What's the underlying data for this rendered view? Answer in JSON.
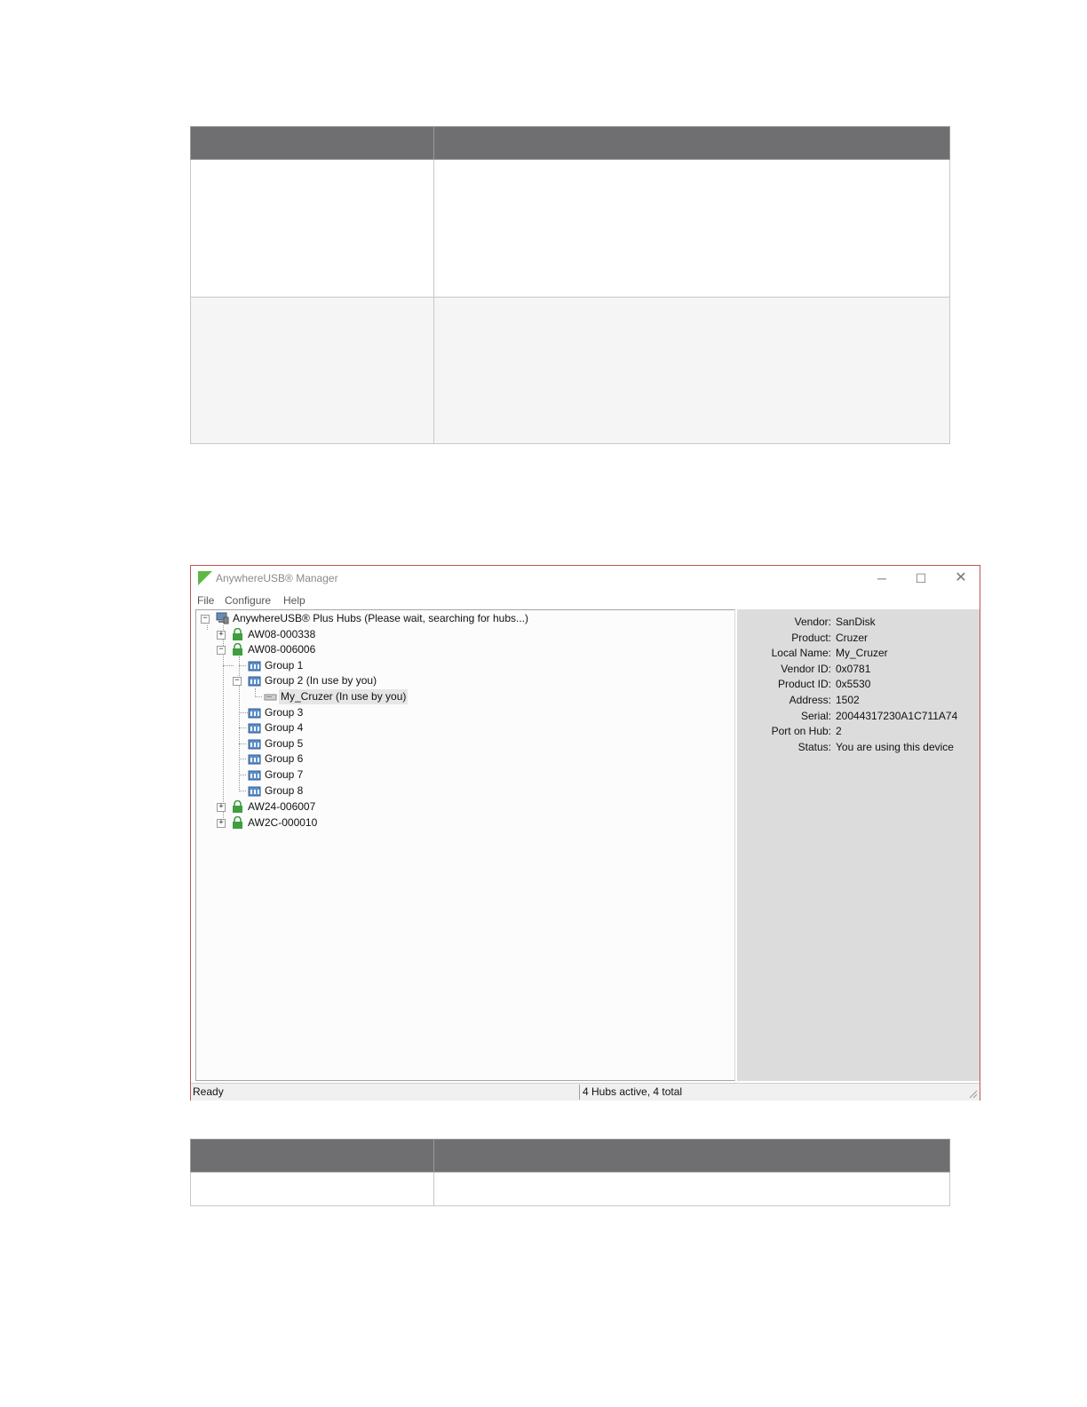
{
  "window": {
    "title": "AnywhereUSB® Manager",
    "controls": {
      "minimize": "─",
      "maximize": "☐",
      "close": "✕"
    }
  },
  "menu": {
    "file": "File",
    "configure": "Configure",
    "help": "Help"
  },
  "tree": {
    "root": "AnywhereUSB® Plus Hubs (Please wait, searching for hubs...)",
    "hub1": "AW08-000338",
    "hub2": "AW08-006006",
    "group1": "Group 1",
    "group2": "Group 2 (In use by you)",
    "device": "My_Cruzer (In use by you)",
    "group3": "Group 3",
    "group4": "Group 4",
    "group5": "Group 5",
    "group6": "Group 6",
    "group7": "Group 7",
    "group8": "Group 8",
    "hub3": "AW24-006007",
    "hub4": "AW2C-000010"
  },
  "details": {
    "vendor_label": "Vendor:",
    "vendor": "SanDisk",
    "product_label": "Product:",
    "product": "Cruzer",
    "local_name_label": "Local Name:",
    "local_name": "My_Cruzer",
    "vendor_id_label": "Vendor ID:",
    "vendor_id": "0x0781",
    "product_id_label": "Product ID:",
    "product_id": "0x5530",
    "address_label": "Address:",
    "address": "1502",
    "serial_label": "Serial:",
    "serial": "20044317230A1C711A74",
    "port_label": "Port on Hub:",
    "port": "2",
    "status_label": "Status:",
    "status": "You are using this device"
  },
  "statusbar": {
    "left": "Ready",
    "right": "4 Hubs active, 4 total"
  },
  "colors": {
    "table_header": "#6f6f71",
    "window_border": "#b9574f",
    "details_bg": "#dcdcdc",
    "logo_green": "#5db845",
    "lock_green": "#3f9e3f",
    "folder_blue": "#5b8fc7"
  }
}
